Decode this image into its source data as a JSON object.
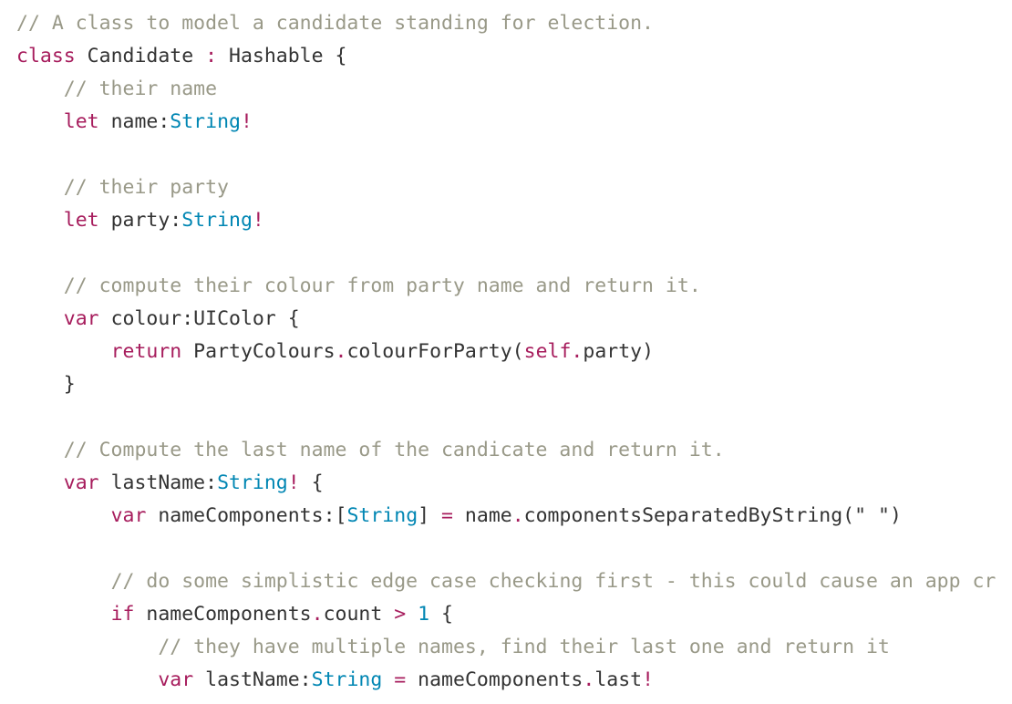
{
  "colors": {
    "background": "#ffffff",
    "plain": "#333333",
    "comment": "#999988",
    "keyword": "#a71d5d",
    "type": "#0086b3"
  },
  "lines": [
    [
      {
        "t": "comment",
        "s": "// A class to model a candidate standing for election."
      }
    ],
    [
      {
        "t": "keyword",
        "s": "class"
      },
      {
        "t": "plain",
        "s": " Candidate "
      },
      {
        "t": "operator",
        "s": ":"
      },
      {
        "t": "plain",
        "s": " Hashable {"
      }
    ],
    [
      {
        "t": "plain",
        "s": "    "
      },
      {
        "t": "comment",
        "s": "// their name"
      }
    ],
    [
      {
        "t": "plain",
        "s": "    "
      },
      {
        "t": "keyword",
        "s": "let"
      },
      {
        "t": "plain",
        "s": " name:"
      },
      {
        "t": "type",
        "s": "String"
      },
      {
        "t": "operator",
        "s": "!"
      }
    ],
    [],
    [
      {
        "t": "plain",
        "s": "    "
      },
      {
        "t": "comment",
        "s": "// their party"
      }
    ],
    [
      {
        "t": "plain",
        "s": "    "
      },
      {
        "t": "keyword",
        "s": "let"
      },
      {
        "t": "plain",
        "s": " party:"
      },
      {
        "t": "type",
        "s": "String"
      },
      {
        "t": "operator",
        "s": "!"
      }
    ],
    [],
    [
      {
        "t": "plain",
        "s": "    "
      },
      {
        "t": "comment",
        "s": "// compute their colour from party name and return it."
      }
    ],
    [
      {
        "t": "plain",
        "s": "    "
      },
      {
        "t": "keyword",
        "s": "var"
      },
      {
        "t": "plain",
        "s": " colour:UIColor {"
      }
    ],
    [
      {
        "t": "plain",
        "s": "        "
      },
      {
        "t": "keyword",
        "s": "return"
      },
      {
        "t": "plain",
        "s": " PartyColours"
      },
      {
        "t": "operator",
        "s": "."
      },
      {
        "t": "plain",
        "s": "colourForParty("
      },
      {
        "t": "keyword",
        "s": "self"
      },
      {
        "t": "operator",
        "s": "."
      },
      {
        "t": "plain",
        "s": "party)"
      }
    ],
    [
      {
        "t": "plain",
        "s": "    }"
      }
    ],
    [],
    [
      {
        "t": "plain",
        "s": "    "
      },
      {
        "t": "comment",
        "s": "// Compute the last name of the candicate and return it."
      }
    ],
    [
      {
        "t": "plain",
        "s": "    "
      },
      {
        "t": "keyword",
        "s": "var"
      },
      {
        "t": "plain",
        "s": " lastName:"
      },
      {
        "t": "type",
        "s": "String"
      },
      {
        "t": "operator",
        "s": "!"
      },
      {
        "t": "plain",
        "s": " {"
      }
    ],
    [
      {
        "t": "plain",
        "s": "        "
      },
      {
        "t": "keyword",
        "s": "var"
      },
      {
        "t": "plain",
        "s": " nameComponents:["
      },
      {
        "t": "type",
        "s": "String"
      },
      {
        "t": "plain",
        "s": "] "
      },
      {
        "t": "operator",
        "s": "="
      },
      {
        "t": "plain",
        "s": " name"
      },
      {
        "t": "operator",
        "s": "."
      },
      {
        "t": "plain",
        "s": "componentsSeparatedByString(\" \")"
      }
    ],
    [],
    [
      {
        "t": "plain",
        "s": "        "
      },
      {
        "t": "comment",
        "s": "// do some simplistic edge case checking first - this could cause an app cr"
      }
    ],
    [
      {
        "t": "plain",
        "s": "        "
      },
      {
        "t": "keyword",
        "s": "if"
      },
      {
        "t": "plain",
        "s": " nameComponents"
      },
      {
        "t": "operator",
        "s": "."
      },
      {
        "t": "plain",
        "s": "count "
      },
      {
        "t": "operator",
        "s": ">"
      },
      {
        "t": "plain",
        "s": " "
      },
      {
        "t": "number",
        "s": "1"
      },
      {
        "t": "plain",
        "s": " {"
      }
    ],
    [
      {
        "t": "plain",
        "s": "            "
      },
      {
        "t": "comment",
        "s": "// they have multiple names, find their last one and return it"
      }
    ],
    [
      {
        "t": "plain",
        "s": "            "
      },
      {
        "t": "keyword",
        "s": "var"
      },
      {
        "t": "plain",
        "s": " lastName:"
      },
      {
        "t": "type",
        "s": "String"
      },
      {
        "t": "plain",
        "s": " "
      },
      {
        "t": "operator",
        "s": "="
      },
      {
        "t": "plain",
        "s": " nameComponents"
      },
      {
        "t": "operator",
        "s": "."
      },
      {
        "t": "plain",
        "s": "last"
      },
      {
        "t": "operator",
        "s": "!"
      }
    ]
  ]
}
